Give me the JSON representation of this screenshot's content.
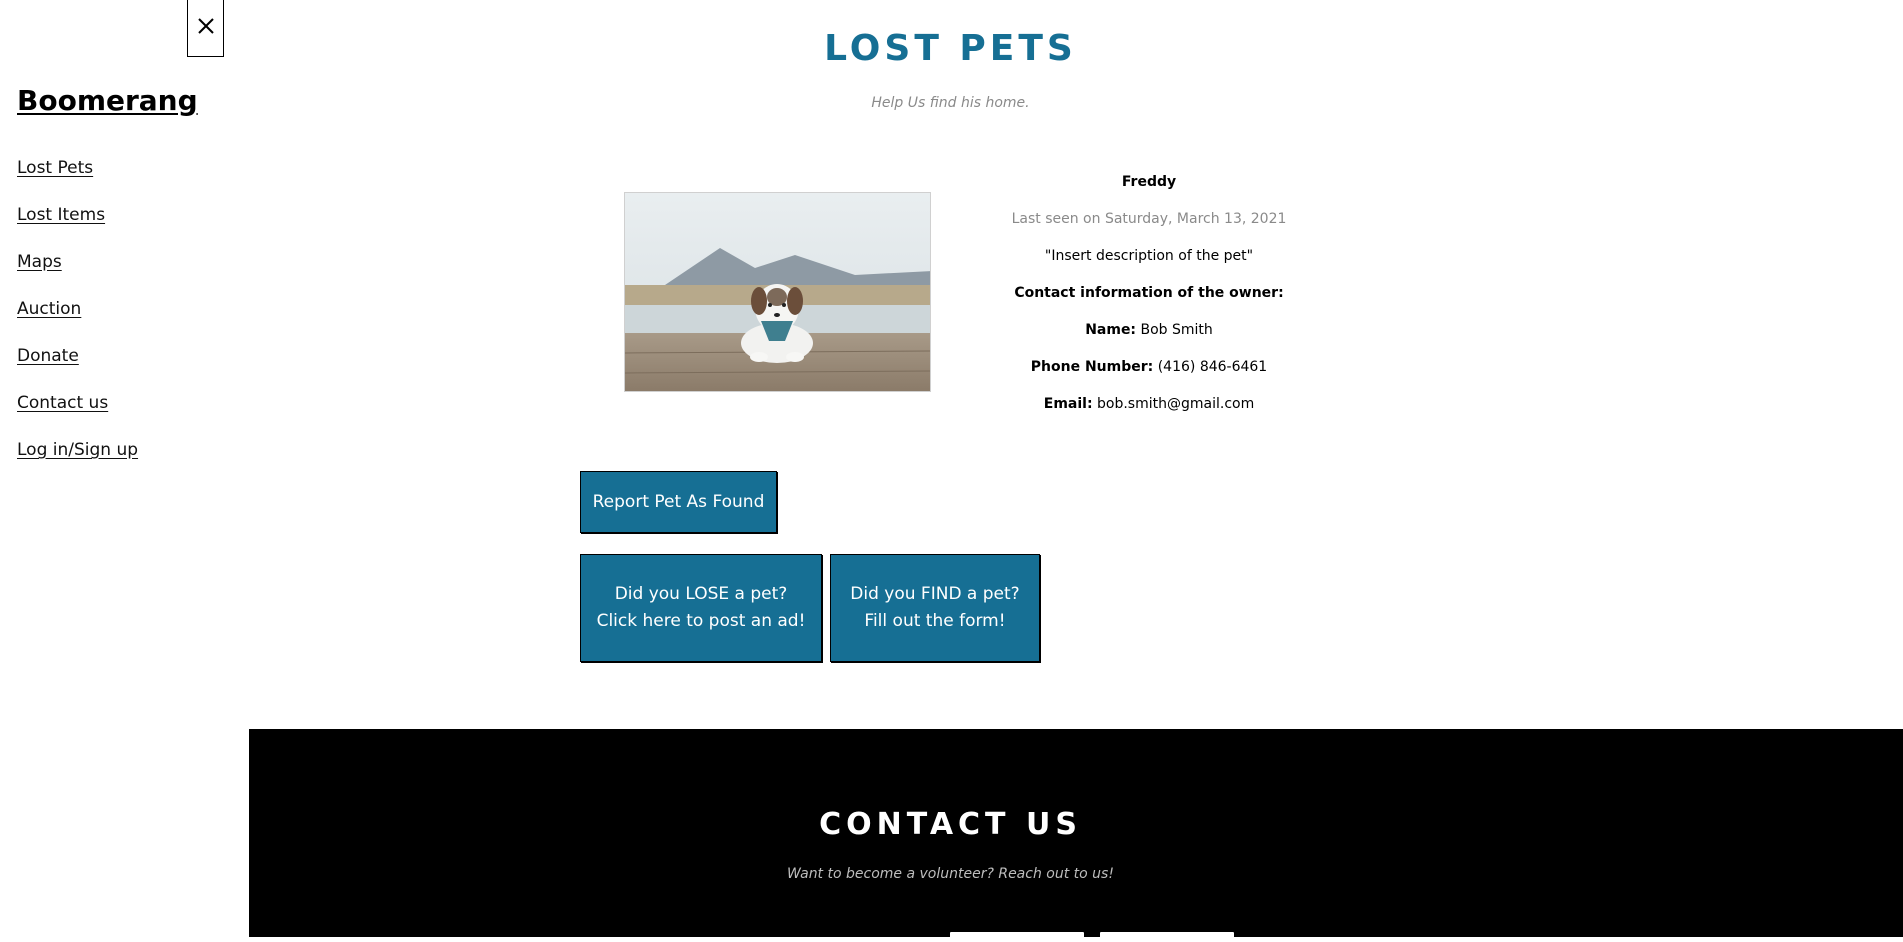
{
  "sidebar": {
    "close_icon": "close-icon",
    "brand": "Boomerang",
    "items": [
      {
        "label": "Lost Pets"
      },
      {
        "label": "Lost Items"
      },
      {
        "label": "Maps"
      },
      {
        "label": "Auction"
      },
      {
        "label": "Donate"
      },
      {
        "label": "Contact us"
      },
      {
        "label": "Log in/Sign up"
      }
    ]
  },
  "main": {
    "title": "LOST PETS",
    "subtitle": "Help Us find his home.",
    "pet": {
      "image": "dog-photo",
      "name": "Freddy",
      "last_seen": "Last seen on Saturday, March 13, 2021",
      "description": "\"Insert description of the pet\"",
      "contact_heading": "Contact information of the owner:",
      "name_label": "Name:",
      "name_value": "Bob Smith",
      "phone_label": "Phone Number:",
      "phone_value": "(416) 846-6461",
      "email_label": "Email:",
      "email_value": "bob.smith@gmail.com"
    },
    "buttons": {
      "report": "Report Pet As Found",
      "lose_line1": "Did you LOSE a pet?",
      "lose_line2": "Click here to post an ad!",
      "find_line1": "Did you FIND a pet?",
      "find_line2": "Fill out the form!"
    }
  },
  "contact": {
    "title": "CONTACT US",
    "subtitle": "Want to become a volunteer? Reach out to us!"
  },
  "colors": {
    "accent": "#166f94",
    "footer_bg": "#000000",
    "muted_text": "#8a8a8a"
  }
}
